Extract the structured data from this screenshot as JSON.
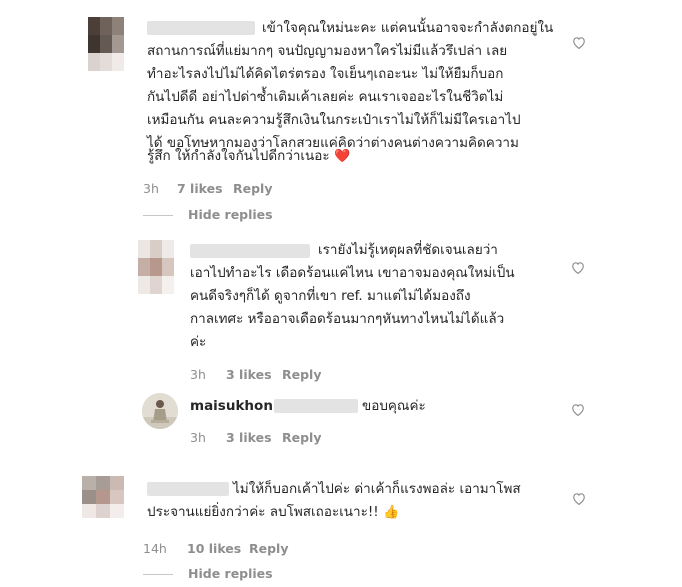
{
  "comments": [
    {
      "lines": [
        "เข้าใจคุณใหม่นะคะ แต่คนนั้นอาจจะกำลังตกอยู่ใน",
        "สถานการณ์ที่แย่มากๆ จนปัญญามองหาใครไม่มีแล้วรึเปล่า เลย",
        "ทำอะไรลงไปไม่ได้คิดไตร่ตรอง ใจเย็นๆเถอะนะ ไม่ให้ยืมก็บอก",
        "กันไปดีดี อย่าไปด่าซ้ำเติมเค้าเลยค่ะ คนเราเจออะไรในชีวิตไม่",
        "เหมือนกัน คนละความรู้สึกเงินในกระเป๋าเราไม่ให้ก็ไม่มีใครเอาไป",
        "ได้ ขอโทษหากมองว่าโลกสวยแค่คิดว่าต่างคนต่างความคิดความ",
        "รู้สึก ให้กำลังใจกันไปดีกว่าเนอะ"
      ],
      "emoji": "❤️",
      "time": "3h",
      "likes": "7 likes",
      "reply": "Reply",
      "hide_replies": "Hide replies"
    },
    {
      "lines": [
        "เรายังไม่รู้เหตุผลที่ชัดเจนเลยว่า",
        "เอาไปทำอะไร เดือดร้อนแค่ไหน เขาอาจมองคุณใหม่เป็น",
        "คนดีจริงๆก็ได้ ดูจากที่เขา ref. มาแต่ไม่ได้มองถึง",
        "กาลเทศะ หรืออาจเดือดร้อนมากๆหันทางไหนไม่ได้แล้ว",
        "ค่ะ"
      ],
      "time": "3h",
      "likes": "3 likes",
      "reply": "Reply"
    },
    {
      "username": "maisukhon",
      "text": "ขอบคุณค่ะ",
      "time": "3h",
      "likes": "3 likes",
      "reply": "Reply"
    },
    {
      "lines": [
        "ไม่ให้ก็บอกเค้าไปค่ะ ด่าเค้าก็แรงพอล่ะ เอามาโพส",
        "ประจานแย่ยิ่งกว่าค่ะ ลบโพสเถอะเนาะ!!"
      ],
      "emoji": "👍",
      "time": "14h",
      "likes": "10 likes",
      "reply": "Reply",
      "hide_replies": "Hide replies"
    }
  ],
  "icons": {
    "like": "heart-outline-icon"
  },
  "colors": {
    "text": "#262626",
    "meta": "#8e8e8e",
    "heart_emoji": "#d8283a"
  }
}
